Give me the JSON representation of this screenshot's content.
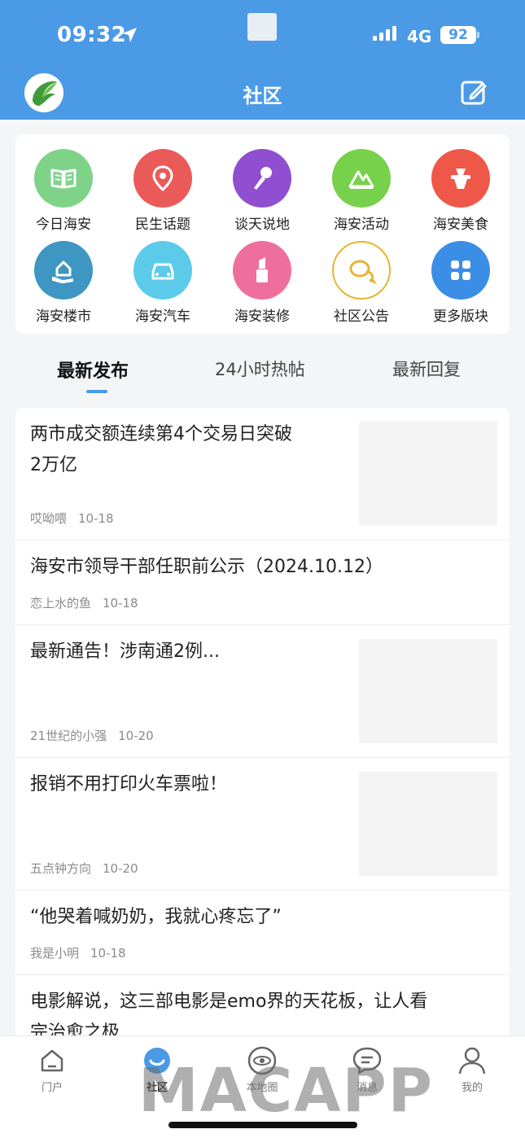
{
  "status_bar": {
    "time": "09:32",
    "network": "4G",
    "battery": "92"
  },
  "nav": {
    "title": "社区",
    "logo_icon": "app-logo-icon",
    "edit_icon": "edit-icon"
  },
  "categories": [
    {
      "label": "今日海安",
      "icon": "book-icon",
      "color": "#7fd389"
    },
    {
      "label": "民生话题",
      "icon": "location-pin-icon",
      "color": "#ea5a58"
    },
    {
      "label": "谈天说地",
      "icon": "microphone-icon",
      "color": "#8f4fd0"
    },
    {
      "label": "海安活动",
      "icon": "mountain-icon",
      "color": "#78d14a"
    },
    {
      "label": "海安美食",
      "icon": "food-bowl-icon",
      "color": "#ef5749"
    },
    {
      "label": "海安楼市",
      "icon": "house-hand-icon",
      "color": "#3e97c2"
    },
    {
      "label": "海安汽车",
      "icon": "car-icon",
      "color": "#5ccbe9"
    },
    {
      "label": "海安装修",
      "icon": "lipstick-icon",
      "color": "#ef6f9c"
    },
    {
      "label": "社区公告",
      "icon": "chat-bubble-icon",
      "color": "#e7b530"
    },
    {
      "label": "更多版块",
      "icon": "grid-icon",
      "color": "#3a8ee6"
    }
  ],
  "tabs": [
    {
      "label": "最新发布"
    },
    {
      "label": "24小时热帖"
    },
    {
      "label": "最新回复"
    }
  ],
  "posts": [
    {
      "title_line1": "两市成交额连续第4个交易日突破",
      "title_line2": "2万亿",
      "author": "哎呦喂",
      "date": "10-18"
    },
    {
      "title_line1": "海安市领导干部任职前公示（2024.10.12）",
      "author": "恋上水的鱼",
      "date": "10-18"
    },
    {
      "title_line1": "最新通告！涉南通2例...",
      "author": "21世纪的小强",
      "date": "10-20"
    },
    {
      "title_line1": "报销不用打印火车票啦！",
      "author": "五点钟方向",
      "date": "10-20"
    },
    {
      "title_line1": "“他哭着喊奶奶，我就心疼忘了”",
      "author": "我是小明",
      "date": "10-18"
    },
    {
      "title_line1": "电影解说，这三部电影是emo界的天花板，让人看",
      "title_line2": "完治愈之极"
    }
  ],
  "bottom_nav": [
    {
      "label": "门户",
      "icon": "portal-icon"
    },
    {
      "label": "社区",
      "icon": "community-icon"
    },
    {
      "label": "本地圈",
      "icon": "local-circle-icon"
    },
    {
      "label": "消息",
      "icon": "message-icon"
    },
    {
      "label": "我的",
      "icon": "profile-icon"
    }
  ],
  "watermark": "MACAPP",
  "colors": {
    "brand_blue": "#4b9ae6"
  }
}
